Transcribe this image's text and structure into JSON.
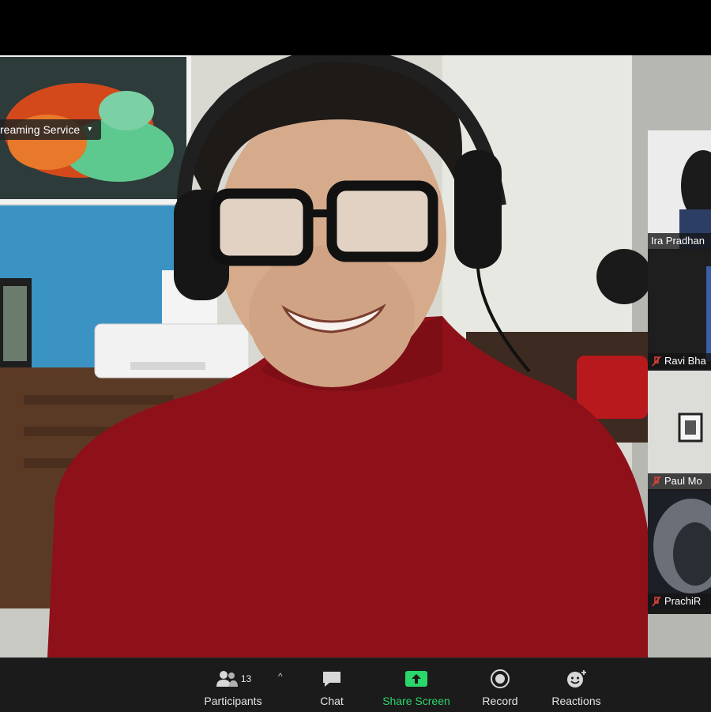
{
  "stream_banner": {
    "label": "reaming Service",
    "caret": "▾"
  },
  "participants_panel": [
    {
      "name": "Ira Pradhan",
      "muted": false
    },
    {
      "name": "Ravi Bha",
      "muted": true
    },
    {
      "name": "Paul Mo",
      "muted": true
    },
    {
      "name": "PrachiR",
      "muted": true
    }
  ],
  "toolbar": {
    "participants": {
      "label": "Participants",
      "count": "13",
      "caret": "^"
    },
    "chat": {
      "label": "Chat"
    },
    "share_screen": {
      "label": "Share Screen"
    },
    "record": {
      "label": "Record"
    },
    "reactions": {
      "label": "Reactions"
    }
  },
  "colors": {
    "share_green": "#2bd66b",
    "toolbar_bg": "#1b1b1b",
    "mute_red": "#e0403a"
  }
}
